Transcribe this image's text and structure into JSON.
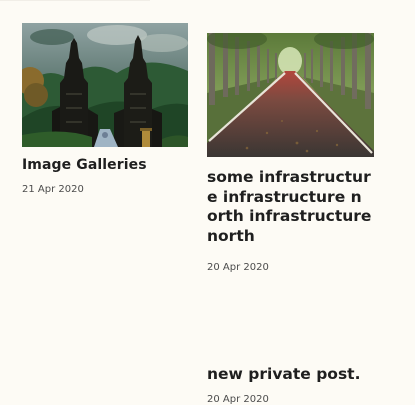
{
  "posts": [
    {
      "title": "Image Galleries",
      "date": "21 Apr 2020",
      "image_icon": "temple-gate-photo"
    },
    {
      "title": "some infrastructure infrastructure north infrastructure north",
      "date": "20 Apr 2020",
      "image_icon": "tree-lined-road-photo"
    },
    {
      "title": "new private post.",
      "date": "20 Apr 2020"
    }
  ],
  "colors": {
    "background": "#fdfbf5",
    "title": "#1f1f1f",
    "date": "#4c4c4c"
  }
}
